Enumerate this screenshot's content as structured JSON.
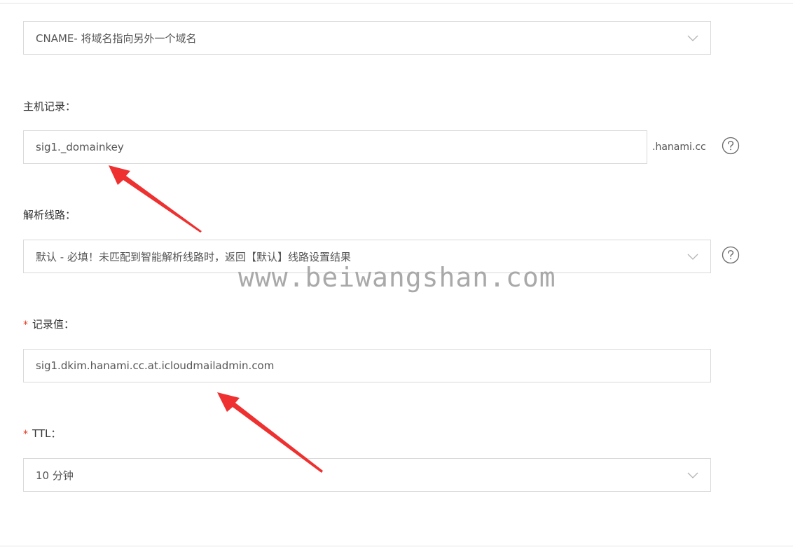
{
  "record_type": {
    "value": "CNAME- 将域名指向另外一个域名"
  },
  "host_record": {
    "label": "主机记录：",
    "value": "sig1._domainkey",
    "suffix": ".hanami.cc"
  },
  "line": {
    "label": "解析线路：",
    "value": "默认 - 必填！未匹配到智能解析线路时，返回【默认】线路设置结果"
  },
  "record_value": {
    "required_mark": "*",
    "label": "记录值：",
    "value": "sig1.dkim.hanami.cc.at.icloudmailadmin.com"
  },
  "ttl": {
    "required_mark": "*",
    "label": "TTL：",
    "value": "10 分钟"
  },
  "watermark": "www.beiwangshan.com",
  "colors": {
    "annotation_arrow": "#ee3030",
    "required": "#e5391f",
    "border": "#d9d9d9"
  },
  "icons": [
    "chevron-down-icon",
    "question-circle-icon",
    "annotation-arrow"
  ]
}
